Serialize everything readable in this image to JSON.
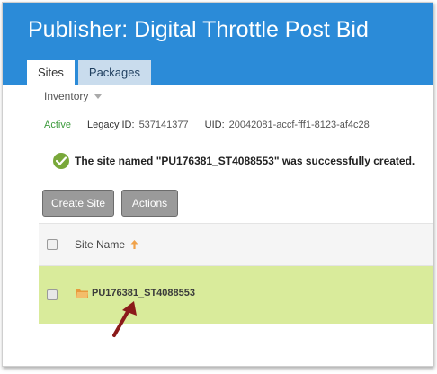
{
  "header": {
    "title_prefix": "Publisher: ",
    "title_name": "Digital Throttle Post Bid"
  },
  "tabs": [
    {
      "label": "Sites",
      "active": true
    },
    {
      "label": "Packages",
      "active": false
    }
  ],
  "inventory": {
    "label": "Inventory",
    "icon": "chevron-down-icon"
  },
  "meta": {
    "status": "Active",
    "legacy_label": "Legacy ID:",
    "legacy_value": "537141377",
    "uid_label": "UID:",
    "uid_value": "20042081-accf-fff1-8123-af4c28"
  },
  "success": {
    "icon": "check-circle-icon",
    "message": "The site named \"PU176381_ST4088553\" was successfully created."
  },
  "buttons": {
    "create_site": "Create Site",
    "actions": "Actions"
  },
  "table": {
    "column_site_name": "Site Name",
    "sort_icon": "sort-ascending-icon",
    "rows": [
      {
        "site_name": "PU176381_ST4088553",
        "icon": "folder-icon",
        "highlighted": true
      }
    ]
  },
  "colors": {
    "header_bg": "#2b8bd8",
    "row_highlight": "#d9eb9b",
    "active_green": "#3c9a3c",
    "success_green": "#79a83a",
    "annotation_arrow": "#8b1a1a"
  }
}
